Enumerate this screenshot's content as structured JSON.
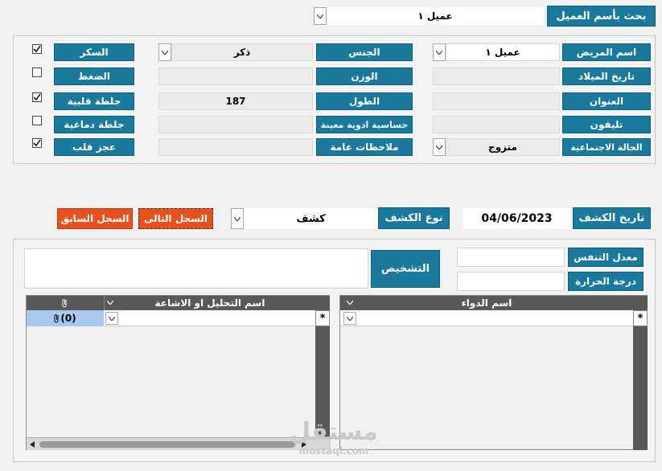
{
  "search": {
    "button_label": "بحث بأسم العميل",
    "value": "عميل ١"
  },
  "patient": {
    "name_label": "اسم المريض",
    "name_value": "عميل ١",
    "gender_label": "الجنس",
    "gender_value": "ذكر",
    "sugar_label": "السكر",
    "birth_label": "تاريخ الميلاد",
    "birth_value": "",
    "weight_label": "الوزن",
    "weight_value": "",
    "pressure_label": "الضغط",
    "address_label": "العنوان",
    "address_value": "",
    "height_label": "الطول",
    "height_value": "187",
    "heart_label": "جلطة قلبية",
    "phone_label": "تليفون",
    "phone_value": "",
    "allergy_label": "حساسية ادوية معينة",
    "allergy_value": "",
    "brain_label": "جلطة دماغية",
    "status_label": "الحالة الاجتماعية",
    "status_value": "متزوج",
    "notes_label": "ملاحظات عامة",
    "notes_value": "",
    "heart_failure_label": "عجز قلب"
  },
  "checks": {
    "sugar": true,
    "pressure": false,
    "heart": true,
    "brain": false,
    "heart_failure": true
  },
  "visit": {
    "date_label": "تاريخ الكشف",
    "date_value": "04/06/2023",
    "type_label": "نوع الكشف",
    "type_value": "كشف",
    "next_label": "السجل التالى",
    "prev_label": "السجل السابق"
  },
  "vitals": {
    "resp_label": "معدل التنفس",
    "resp_value": "",
    "temp_label": "درجة الحرارة",
    "temp_value": "",
    "diagnosis_label": "التشخيص",
    "diagnosis_value": ""
  },
  "grids": {
    "drug_header": "اسم الدواء",
    "lab_header": "اسم التحليل او الاشاعة",
    "attach_value": "(0)",
    "new_row_marker": "*"
  },
  "watermark": {
    "ar": "مستقل",
    "en": "mostaql.com"
  },
  "colors": {
    "accent": "#1a7a9e",
    "danger": "#e8501c"
  }
}
